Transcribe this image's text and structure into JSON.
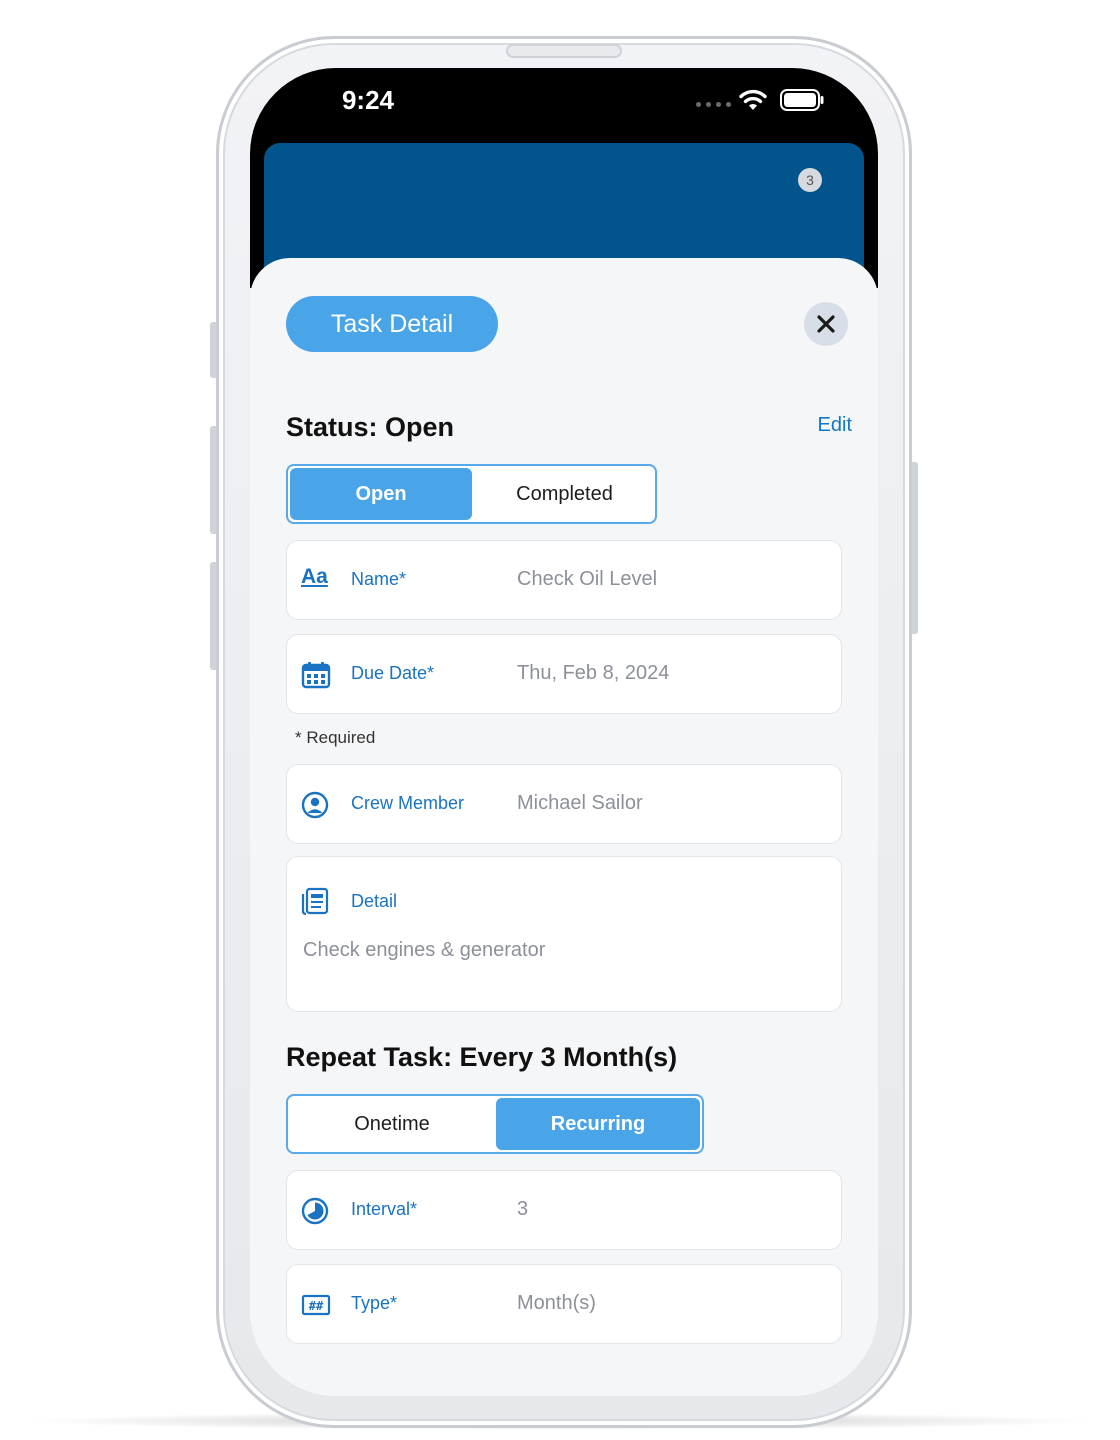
{
  "status_bar": {
    "time": "9:24"
  },
  "header": {
    "badge_count": "3"
  },
  "sheet": {
    "title": "Task Detail",
    "status_title": "Status: Open",
    "edit_label": "Edit",
    "status_segment": {
      "options": [
        "Open",
        "Completed"
      ],
      "selected": "Open"
    },
    "fields": {
      "name": {
        "label": "Name*",
        "value": "Check Oil Level",
        "icon": "text-format-icon",
        "icon_text": "Aa"
      },
      "due_date": {
        "label": "Due Date*",
        "value": "Thu, Feb 8, 2024",
        "icon": "calendar-icon"
      },
      "crew_member": {
        "label": "Crew Member",
        "value": "Michael Sailor",
        "icon": "person-circle-icon"
      },
      "detail": {
        "label": "Detail",
        "value": "Check engines & generator",
        "icon": "document-icon"
      },
      "interval": {
        "label": "Interval*",
        "value": "3",
        "icon": "clock-pie-icon"
      },
      "type": {
        "label": "Type*",
        "value": "Month(s)",
        "icon": "hash-grid-icon"
      }
    },
    "required_note": "* Required",
    "repeat_title": "Repeat Task: Every 3 Month(s)",
    "repeat_segment": {
      "options": [
        "Onetime",
        "Recurring"
      ],
      "selected": "Recurring"
    }
  },
  "colors": {
    "header_blue": "#02548c",
    "accent": "#4aa5e8",
    "link_blue": "#1a73c2"
  }
}
